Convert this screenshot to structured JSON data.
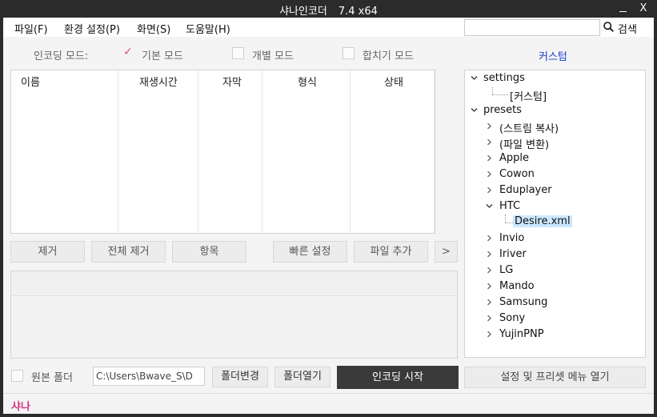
{
  "window": {
    "title": "샤나인코더",
    "version": "7.4 x64",
    "close_symbol": "X"
  },
  "menu": [
    {
      "label": "파일(F)"
    },
    {
      "label": "환경 설정(P)"
    },
    {
      "label": "화면(S)"
    },
    {
      "label": "도움말(H)"
    }
  ],
  "search": {
    "value": "",
    "button_label": "검색"
  },
  "mode": {
    "label": "인코딩 모드:",
    "options": [
      {
        "label": "기본 모드",
        "checked": true
      },
      {
        "label": "개별 모드",
        "checked": false
      },
      {
        "label": "합치기 모드",
        "checked": false
      }
    ],
    "check_symbol": "✓"
  },
  "custom_link": "커스텀",
  "file_list": {
    "columns": [
      "이름",
      "재생시간",
      "자막",
      "형식",
      "상태"
    ]
  },
  "list_buttons": {
    "remove": "제거",
    "remove_all": "전체 제거",
    "items": "항목",
    "quick_settings": "빠른 설정",
    "add_file": "파일 추가",
    "more": ">"
  },
  "tree": {
    "settings": "settings",
    "custom": "[커스텀]",
    "presets": "presets",
    "items": [
      "(스트림 복사)",
      "(파일 변환)",
      "Apple",
      "Cowon",
      "Eduplayer",
      "HTC",
      "Invio",
      "Iriver",
      "LG",
      "Mando",
      "Samsung",
      "Sony",
      "YujinPNP"
    ],
    "htc_child": "Desire.xml"
  },
  "bottom": {
    "source_folder_label": "원본 폴더",
    "output_path": "C:\\Users\\Bwave_S\\D",
    "change_folder": "폴더변경",
    "open_folder": "폴더열기",
    "start_encoding": "인코딩 시작",
    "open_settings": "설정 및 프리셋 메뉴 열기"
  },
  "status": {
    "text": "샤나"
  },
  "colors": {
    "accent_pink": "#d63384",
    "link_blue": "#1a3bd0",
    "check": "#e04c6a",
    "start_button": "#3a3a3a"
  }
}
